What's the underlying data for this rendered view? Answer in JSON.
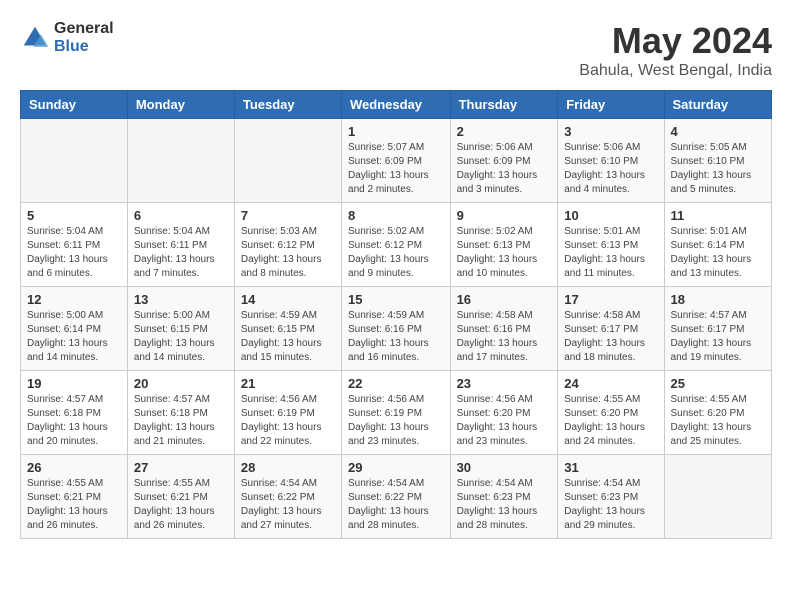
{
  "header": {
    "logo_general": "General",
    "logo_blue": "Blue",
    "main_title": "May 2024",
    "subtitle": "Bahula, West Bengal, India"
  },
  "days_of_week": [
    "Sunday",
    "Monday",
    "Tuesday",
    "Wednesday",
    "Thursday",
    "Friday",
    "Saturday"
  ],
  "weeks": [
    [
      {
        "day": "",
        "info": ""
      },
      {
        "day": "",
        "info": ""
      },
      {
        "day": "",
        "info": ""
      },
      {
        "day": "1",
        "info": "Sunrise: 5:07 AM\nSunset: 6:09 PM\nDaylight: 13 hours and 2 minutes."
      },
      {
        "day": "2",
        "info": "Sunrise: 5:06 AM\nSunset: 6:09 PM\nDaylight: 13 hours and 3 minutes."
      },
      {
        "day": "3",
        "info": "Sunrise: 5:06 AM\nSunset: 6:10 PM\nDaylight: 13 hours and 4 minutes."
      },
      {
        "day": "4",
        "info": "Sunrise: 5:05 AM\nSunset: 6:10 PM\nDaylight: 13 hours and 5 minutes."
      }
    ],
    [
      {
        "day": "5",
        "info": "Sunrise: 5:04 AM\nSunset: 6:11 PM\nDaylight: 13 hours and 6 minutes."
      },
      {
        "day": "6",
        "info": "Sunrise: 5:04 AM\nSunset: 6:11 PM\nDaylight: 13 hours and 7 minutes."
      },
      {
        "day": "7",
        "info": "Sunrise: 5:03 AM\nSunset: 6:12 PM\nDaylight: 13 hours and 8 minutes."
      },
      {
        "day": "8",
        "info": "Sunrise: 5:02 AM\nSunset: 6:12 PM\nDaylight: 13 hours and 9 minutes."
      },
      {
        "day": "9",
        "info": "Sunrise: 5:02 AM\nSunset: 6:13 PM\nDaylight: 13 hours and 10 minutes."
      },
      {
        "day": "10",
        "info": "Sunrise: 5:01 AM\nSunset: 6:13 PM\nDaylight: 13 hours and 11 minutes."
      },
      {
        "day": "11",
        "info": "Sunrise: 5:01 AM\nSunset: 6:14 PM\nDaylight: 13 hours and 13 minutes."
      }
    ],
    [
      {
        "day": "12",
        "info": "Sunrise: 5:00 AM\nSunset: 6:14 PM\nDaylight: 13 hours and 14 minutes."
      },
      {
        "day": "13",
        "info": "Sunrise: 5:00 AM\nSunset: 6:15 PM\nDaylight: 13 hours and 14 minutes."
      },
      {
        "day": "14",
        "info": "Sunrise: 4:59 AM\nSunset: 6:15 PM\nDaylight: 13 hours and 15 minutes."
      },
      {
        "day": "15",
        "info": "Sunrise: 4:59 AM\nSunset: 6:16 PM\nDaylight: 13 hours and 16 minutes."
      },
      {
        "day": "16",
        "info": "Sunrise: 4:58 AM\nSunset: 6:16 PM\nDaylight: 13 hours and 17 minutes."
      },
      {
        "day": "17",
        "info": "Sunrise: 4:58 AM\nSunset: 6:17 PM\nDaylight: 13 hours and 18 minutes."
      },
      {
        "day": "18",
        "info": "Sunrise: 4:57 AM\nSunset: 6:17 PM\nDaylight: 13 hours and 19 minutes."
      }
    ],
    [
      {
        "day": "19",
        "info": "Sunrise: 4:57 AM\nSunset: 6:18 PM\nDaylight: 13 hours and 20 minutes."
      },
      {
        "day": "20",
        "info": "Sunrise: 4:57 AM\nSunset: 6:18 PM\nDaylight: 13 hours and 21 minutes."
      },
      {
        "day": "21",
        "info": "Sunrise: 4:56 AM\nSunset: 6:19 PM\nDaylight: 13 hours and 22 minutes."
      },
      {
        "day": "22",
        "info": "Sunrise: 4:56 AM\nSunset: 6:19 PM\nDaylight: 13 hours and 23 minutes."
      },
      {
        "day": "23",
        "info": "Sunrise: 4:56 AM\nSunset: 6:20 PM\nDaylight: 13 hours and 23 minutes."
      },
      {
        "day": "24",
        "info": "Sunrise: 4:55 AM\nSunset: 6:20 PM\nDaylight: 13 hours and 24 minutes."
      },
      {
        "day": "25",
        "info": "Sunrise: 4:55 AM\nSunset: 6:20 PM\nDaylight: 13 hours and 25 minutes."
      }
    ],
    [
      {
        "day": "26",
        "info": "Sunrise: 4:55 AM\nSunset: 6:21 PM\nDaylight: 13 hours and 26 minutes."
      },
      {
        "day": "27",
        "info": "Sunrise: 4:55 AM\nSunset: 6:21 PM\nDaylight: 13 hours and 26 minutes."
      },
      {
        "day": "28",
        "info": "Sunrise: 4:54 AM\nSunset: 6:22 PM\nDaylight: 13 hours and 27 minutes."
      },
      {
        "day": "29",
        "info": "Sunrise: 4:54 AM\nSunset: 6:22 PM\nDaylight: 13 hours and 28 minutes."
      },
      {
        "day": "30",
        "info": "Sunrise: 4:54 AM\nSunset: 6:23 PM\nDaylight: 13 hours and 28 minutes."
      },
      {
        "day": "31",
        "info": "Sunrise: 4:54 AM\nSunset: 6:23 PM\nDaylight: 13 hours and 29 minutes."
      },
      {
        "day": "",
        "info": ""
      }
    ]
  ]
}
